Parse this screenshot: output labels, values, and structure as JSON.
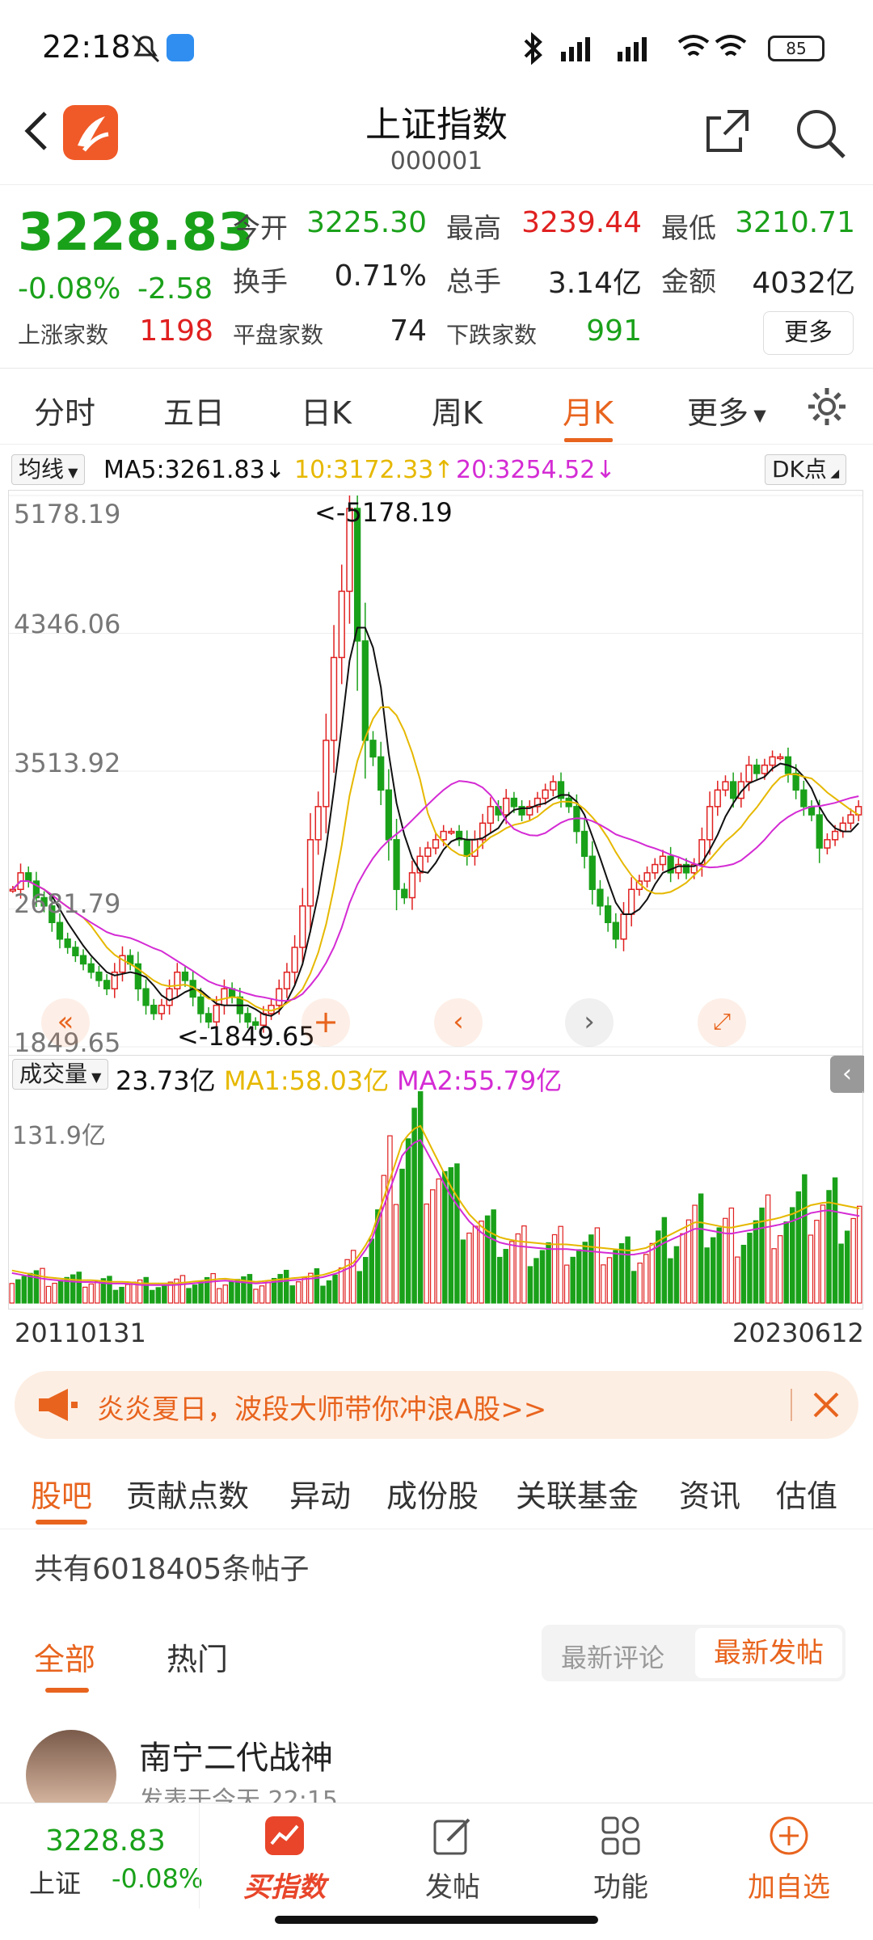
{
  "status": {
    "time": "22:18",
    "battery": "85"
  },
  "header": {
    "title": "上证指数",
    "code": "000001"
  },
  "quote": {
    "price": "3228.83",
    "change_pct": "-0.08%",
    "change": "-2.58",
    "open_label": "今开",
    "open": "3225.30",
    "high_label": "最高",
    "high": "3239.44",
    "low_label": "最低",
    "low": "3210.71",
    "turnover_label": "换手",
    "turnover": "0.71%",
    "volume_label": "总手",
    "volume": "3.14亿",
    "amount_label": "金额",
    "amount": "4032亿",
    "up_label": "上涨家数",
    "up": "1198",
    "flat_label": "平盘家数",
    "flat": "74",
    "down_label": "下跌家数",
    "down": "991",
    "more": "更多"
  },
  "ktabs": [
    "分时",
    "五日",
    "日K",
    "周K",
    "月K",
    "更多"
  ],
  "ma": {
    "selector": "均线",
    "ma5": "MA5:3261.83",
    "ma10": "10:3172.33",
    "ma20": "20:3254.52",
    "dk": "DK点"
  },
  "chart_labels": {
    "y1": "5178.19",
    "y2": "4346.06",
    "y3": "3513.92",
    "y4": "2681.79",
    "y5": "1849.65",
    "high_mark": "<-5178.19",
    "low_mark": "<-1849.65"
  },
  "volume": {
    "selector": "成交量",
    "value": "23.73亿",
    "ma1": "MA1:58.03亿",
    "ma2": "MA2:55.79亿",
    "ymax": "131.9亿",
    "start_date": "20110131",
    "end_date": "20230612"
  },
  "colors": {
    "up": "#e02020",
    "down": "#1aa11a",
    "accent": "#e8641e",
    "ma5": "#111111",
    "ma10": "#e6b800",
    "ma20": "#d42bd4"
  },
  "promo": {
    "text": "炎炎夏日，波段大师带你冲浪A股>>"
  },
  "forum_tabs": [
    "股吧",
    "贡献点数",
    "异动",
    "成份股",
    "关联基金",
    "资讯",
    "估值"
  ],
  "forum": {
    "post_count": "共有6018405条帖子",
    "tab_all": "全部",
    "tab_hot": "热门",
    "sort_comment": "最新评论",
    "sort_post": "最新发帖"
  },
  "post": {
    "author": "南宁二代战神",
    "time": "发表于今天 22:15"
  },
  "bottom": {
    "price": "3228.83",
    "name": "上证",
    "pct": "-0.08%",
    "items": [
      "买指数",
      "发帖",
      "功能",
      "加自选"
    ]
  },
  "chart_data": {
    "type": "candlestick",
    "title": "上证指数 月K",
    "ylim": [
      1849.65,
      5178.19
    ],
    "y_ticks": [
      5178.19,
      4346.06,
      3513.92,
      2681.79,
      1849.65
    ],
    "x_range": [
      "20110131",
      "20230612"
    ],
    "max": 5178.19,
    "min": 1849.65,
    "close_trend": [
      2800,
      2900,
      2850,
      2750,
      2700,
      2600,
      2500,
      2450,
      2400,
      2350,
      2300,
      2250,
      2200,
      2300,
      2400,
      2350,
      2200,
      2100,
      2050,
      2100,
      2200,
      2300,
      2250,
      2150,
      2050,
      2000,
      2100,
      2200,
      2150,
      2050,
      2000,
      1980,
      2050,
      2100,
      2200,
      2300,
      2450,
      2700,
      3100,
      3300,
      3700,
      4200,
      4600,
      5100,
      4300,
      3700,
      3600,
      3400,
      3100,
      2800,
      2750,
      2900,
      3000,
      3050,
      3100,
      3150,
      3150,
      3100,
      3000,
      3100,
      3200,
      3300,
      3250,
      3350,
      3300,
      3250,
      3300,
      3350,
      3400,
      3450,
      3350,
      3300,
      3150,
      3000,
      2800,
      2700,
      2600,
      2500,
      2650,
      2800,
      2850,
      2900,
      2950,
      3000,
      2900,
      2950,
      2900,
      2950,
      3100,
      3300,
      3400,
      3450,
      3350,
      3450,
      3550,
      3500,
      3550,
      3600,
      3600,
      3500,
      3400,
      3300,
      3250,
      3050,
      3100,
      3150,
      3200,
      3250,
      3300
    ],
    "volume_ma_trend": [
      20,
      18,
      16,
      15,
      14,
      14,
      13,
      13,
      12,
      12,
      12,
      13,
      14,
      15,
      14,
      13,
      14,
      15,
      16,
      17,
      20,
      25,
      40,
      70,
      100,
      110,
      90,
      70,
      55,
      45,
      40,
      38,
      37,
      36,
      36,
      35,
      34,
      33,
      32,
      34,
      40,
      45,
      50,
      48,
      46,
      48,
      50,
      52,
      55,
      60,
      62,
      60,
      58
    ]
  }
}
